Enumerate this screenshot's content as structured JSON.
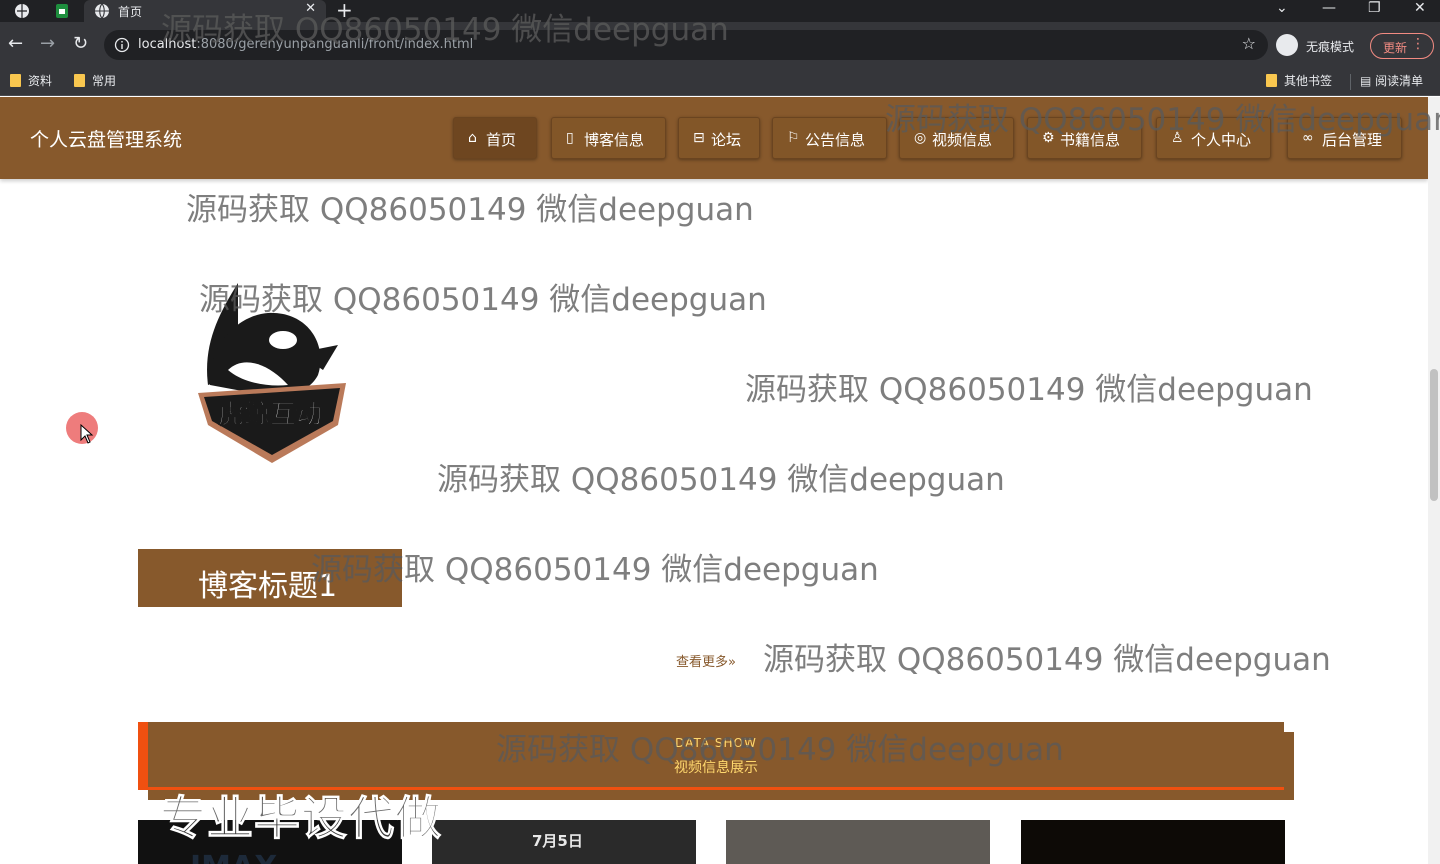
{
  "browser": {
    "tab_title": "首页",
    "url_host": "localhost",
    "url_rest": ":8080/gerenyunpanguanli/front/index.html",
    "incognito_label": "无痕模式",
    "update_label": "更新",
    "bookmarks": [
      "资料",
      "常用"
    ],
    "other_bookmarks": "其他书签",
    "reading_list": "阅读清单"
  },
  "site": {
    "title": "个人云盘管理系统",
    "nav": [
      {
        "icon": "home-icon",
        "label": "首页",
        "active": true
      },
      {
        "icon": "blog-icon",
        "label": "博客信息"
      },
      {
        "icon": "forum-icon",
        "label": "论坛"
      },
      {
        "icon": "flag-icon",
        "label": "公告信息"
      },
      {
        "icon": "video-icon",
        "label": "视频信息"
      },
      {
        "icon": "book-icon",
        "label": "书籍信息"
      },
      {
        "icon": "user-icon",
        "label": "个人中心"
      },
      {
        "icon": "link-icon",
        "label": "后台管理"
      }
    ]
  },
  "blog": {
    "logo_text": "虎鲸互动",
    "title": "博客标题1",
    "more": "查看更多»"
  },
  "video_section": {
    "en": "DATA SHOW",
    "cn": "视频信息展示",
    "thumbs": [
      "IMAX",
      "7月5日",
      "",
      ""
    ]
  },
  "watermark": {
    "text": "源码获取 QQ86050149 微信deepguan",
    "big": "专业毕设代做"
  },
  "colors": {
    "brand": "#87592c",
    "accent": "#f05010",
    "section_text": "#ffd86e"
  }
}
